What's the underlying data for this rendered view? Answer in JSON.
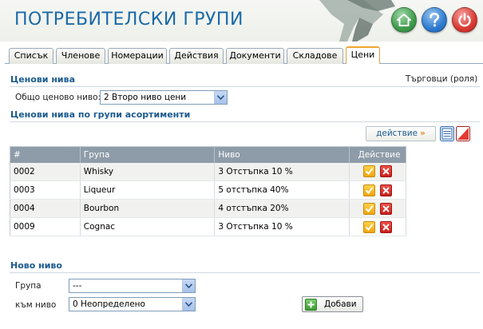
{
  "app": {
    "title": "ПОТРЕБИТЕЛСКИ ГРУПИ"
  },
  "header_buttons": [
    {
      "name": "home",
      "icon": "home-icon"
    },
    {
      "name": "help",
      "icon": "help-icon"
    },
    {
      "name": "logout",
      "icon": "power-icon"
    }
  ],
  "tabs": [
    {
      "label": "Списък"
    },
    {
      "label": "Членове"
    },
    {
      "label": "Номерации"
    },
    {
      "label": "Действия"
    },
    {
      "label": "Документи"
    },
    {
      "label": "Складове"
    },
    {
      "label": "Цени",
      "active": true
    }
  ],
  "price_levels": {
    "title": "Ценови нива",
    "role": "Търговци (роля)",
    "general_label": "Общо ценово ниво:",
    "general_value": "2 Второ ниво цени"
  },
  "assortment": {
    "title": "Ценови нива по групи асортименти",
    "action_button": "действие",
    "columns": [
      "#",
      "Група",
      "Ниво",
      "Действие"
    ],
    "rows": [
      {
        "id": "0002",
        "group": "Whisky",
        "level": "3 Отстъпка 10 %"
      },
      {
        "id": "0003",
        "group": "Liqueur",
        "level": "5 отстъпка 40%"
      },
      {
        "id": "0004",
        "group": "Bourbon",
        "level": "4 отстъпка 20%"
      },
      {
        "id": "0009",
        "group": "Cognac",
        "level": "3 Отстъпка 10 %"
      }
    ]
  },
  "new_level": {
    "title": "Ново ниво",
    "group_label": "Група",
    "group_value": "---",
    "level_label": "към ниво",
    "level_value": "0 Неопределено",
    "add_button": "Добави"
  },
  "colors": {
    "title_blue": "#1a6aa8",
    "section_blue": "#1b5a8f",
    "table_header": "#8e9ca9",
    "active_tab": "#f0a630"
  }
}
